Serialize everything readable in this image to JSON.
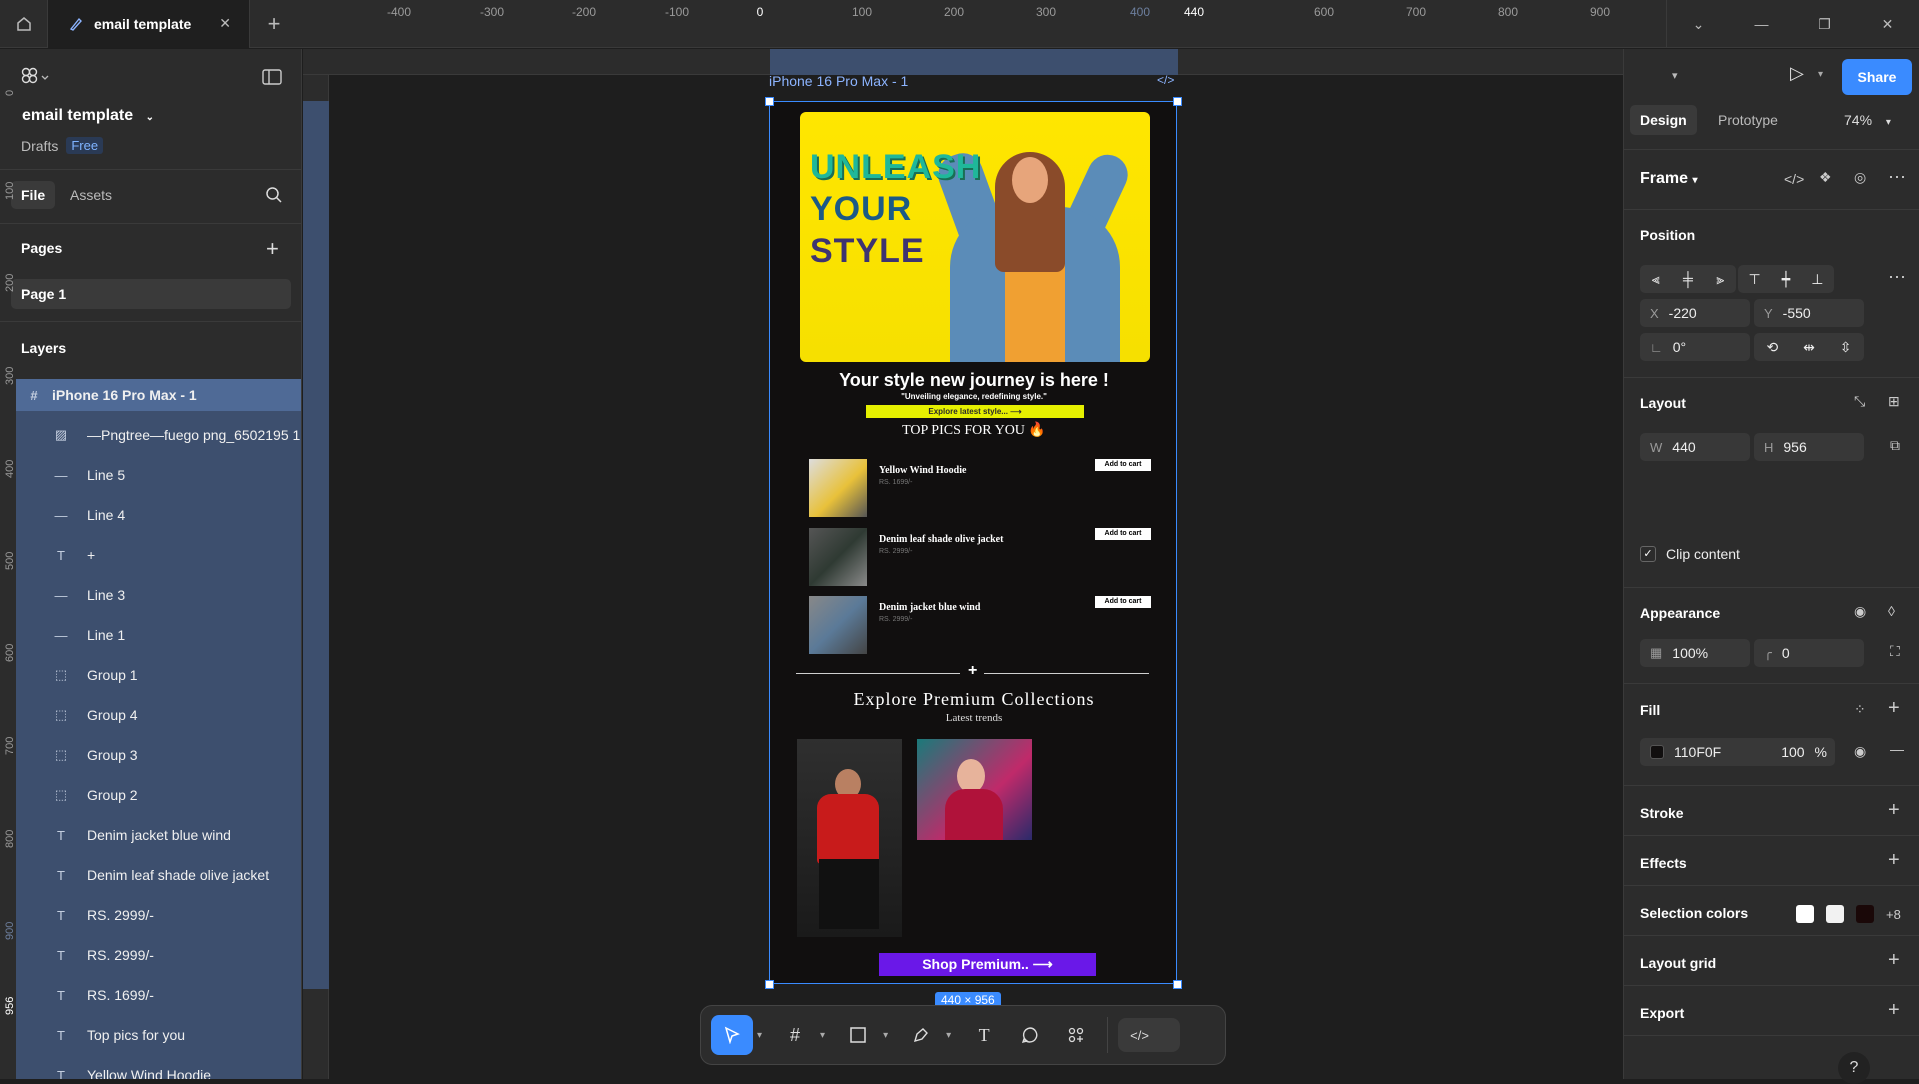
{
  "tabs": {
    "title": "email template",
    "new_tab": "+"
  },
  "window": {
    "minimize": "—",
    "restore": "❐",
    "close": "✕",
    "dropdown": "⌄"
  },
  "file": {
    "name": "email template",
    "location": "Drafts",
    "plan": "Free"
  },
  "left_tabs": {
    "file": "File",
    "assets": "Assets"
  },
  "pages": {
    "title": "Pages",
    "items": [
      "Page 1"
    ]
  },
  "layers": {
    "title": "Layers",
    "items": [
      {
        "icon": "#",
        "label": "iPhone 16 Pro Max - 1"
      },
      {
        "icon": "▨",
        "label": "—Pngtree—fuego png_6502195 1"
      },
      {
        "icon": "—",
        "label": "Line 5"
      },
      {
        "icon": "—",
        "label": "Line 4"
      },
      {
        "icon": "T",
        "label": "+"
      },
      {
        "icon": "—",
        "label": "Line 3"
      },
      {
        "icon": "—",
        "label": "Line 1"
      },
      {
        "icon": "⬚",
        "label": "Group 1"
      },
      {
        "icon": "⬚",
        "label": "Group 4"
      },
      {
        "icon": "⬚",
        "label": "Group 3"
      },
      {
        "icon": "⬚",
        "label": "Group 2"
      },
      {
        "icon": "T",
        "label": "Denim jacket blue wind"
      },
      {
        "icon": "T",
        "label": "Denim leaf shade olive jacket"
      },
      {
        "icon": "T",
        "label": "RS. 2999/-"
      },
      {
        "icon": "T",
        "label": "RS. 2999/-"
      },
      {
        "icon": "T",
        "label": "RS. 1699/-"
      },
      {
        "icon": "T",
        "label": "Top pics for you"
      },
      {
        "icon": "T",
        "label": "Yellow Wind Hoodie"
      }
    ]
  },
  "ruler": {
    "top": [
      "-400",
      "-300",
      "-200",
      "-100",
      "0",
      "100",
      "200",
      "300",
      "400",
      "440",
      "600",
      "700",
      "800",
      "900"
    ],
    "left": [
      "0",
      "100",
      "200",
      "300",
      "400",
      "500",
      "600",
      "700",
      "800",
      "900",
      "956"
    ]
  },
  "frame": {
    "label": "iPhone 16 Pro Max - 1",
    "size": "440 × 956"
  },
  "email": {
    "hero_lines": [
      "UNLEASH",
      "YOUR",
      "STYLE"
    ],
    "title": "Your style new journey is here !",
    "subtitle": "\"Unveiling elegance, redefining style.\"",
    "cta": "Explore latest style... ⟶",
    "top_picks": "TOP PICS FOR YOU 🔥",
    "products": [
      {
        "name": "Yellow Wind Hoodie",
        "price": "RS. 1699/-",
        "button": "Add to cart"
      },
      {
        "name": "Denim leaf shade olive jacket",
        "price": "RS. 2999/-",
        "button": "Add to cart"
      },
      {
        "name": "Denim jacket blue wind",
        "price": "RS. 2999/-",
        "button": "Add to cart"
      }
    ],
    "divider_symbol": "+",
    "explore": "Explore Premium Collections",
    "latest": "Latest trends",
    "shop": "Shop Premium.. ⟶"
  },
  "right": {
    "share": "Share",
    "tab_design": "Design",
    "tab_prototype": "Prototype",
    "zoom": "74%",
    "frame_type": "Frame",
    "position_title": "Position",
    "x_label": "X",
    "x_value": "-220",
    "y_label": "Y",
    "y_value": "-550",
    "rotation": "0°",
    "layout_title": "Layout",
    "w_label": "W",
    "w_value": "440",
    "h_label": "H",
    "h_value": "956",
    "clip_content": "Clip content",
    "appearance_title": "Appearance",
    "opacity": "100%",
    "radius": "0",
    "fill_title": "Fill",
    "fill_hex": "110F0F",
    "fill_opacity": "100",
    "fill_pct": "%",
    "stroke_title": "Stroke",
    "effects_title": "Effects",
    "selection_colors_title": "Selection colors",
    "selection_colors_more": "+8",
    "layout_grid_title": "Layout grid",
    "export_title": "Export",
    "help": "?"
  },
  "colors": {
    "accent": "#3a8bff",
    "fill": "#110F0F",
    "hero_yellow": "#ffe600",
    "shop_purple": "#6a18e8",
    "sel1": "#ffffff",
    "sel2": "#f2f2f2",
    "sel3": "#1a0808"
  }
}
